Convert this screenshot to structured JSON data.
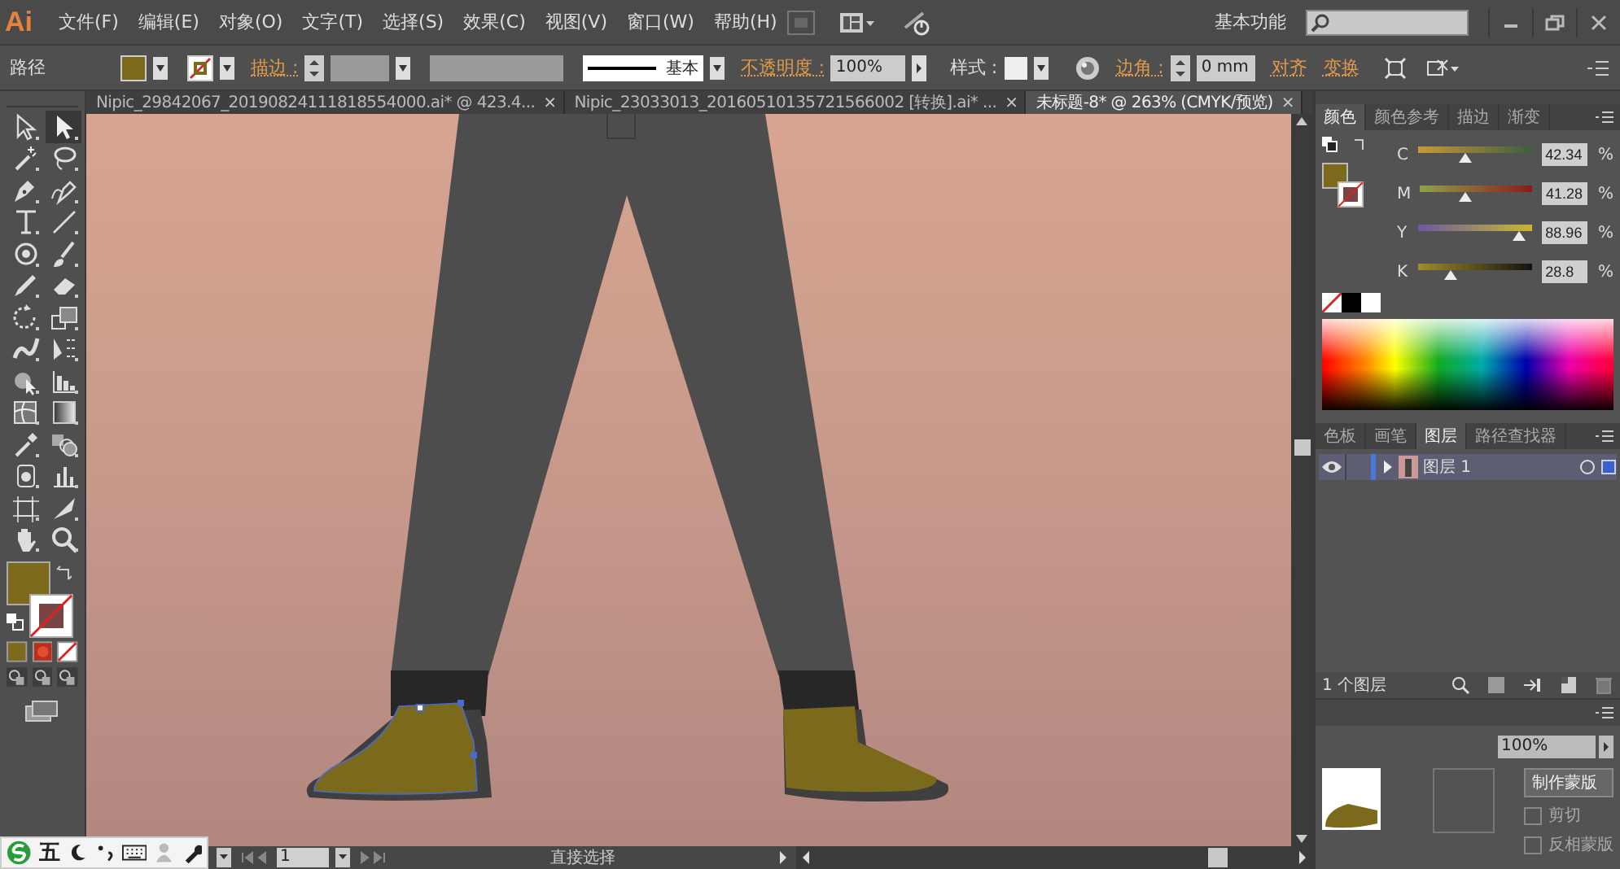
{
  "menu_bar": {
    "logo": "Ai",
    "items": [
      "文件(F)",
      "编辑(E)",
      "对象(O)",
      "文字(T)",
      "选择(S)",
      "效果(C)",
      "视图(V)",
      "窗口(W)",
      "帮助(H)"
    ],
    "workspace": "基本功能"
  },
  "control_bar": {
    "selection": "路径",
    "stroke_link": "描边 :",
    "profile": "基本",
    "opacity_link": "不透明度 :",
    "opacity": "100%",
    "style_label": "样式 :",
    "corner_link": "边角 :",
    "corner": "0 mm",
    "align_link": "对齐",
    "transform_link": "变换"
  },
  "tabs": [
    {
      "label": "Nipic_29842067_20190824111818554000.ai* @ 423.4...",
      "close": "×",
      "selected": false
    },
    {
      "label": "Nipic_23033013_20160510135721566002 [转换].ai* ...",
      "close": "×",
      "selected": false
    },
    {
      "label": "未标题-8* @ 263% (CMYK/预览)",
      "close": "×",
      "selected": true
    }
  ],
  "tools": [
    {
      "kind": "selection",
      "selected": false
    },
    {
      "kind": "direct",
      "selected": true
    },
    {
      "kind": "wand",
      "selected": false
    },
    {
      "kind": "lasso",
      "selected": false
    },
    {
      "kind": "pen",
      "selected": false
    },
    {
      "kind": "curvature",
      "selected": false
    },
    {
      "kind": "type",
      "selected": false
    },
    {
      "kind": "line",
      "selected": false
    },
    {
      "kind": "ellipse",
      "selected": false
    },
    {
      "kind": "brush",
      "selected": false
    },
    {
      "kind": "pencil",
      "selected": false
    },
    {
      "kind": "eraser",
      "selected": false
    },
    {
      "kind": "rotate",
      "selected": false
    },
    {
      "kind": "scale",
      "selected": false
    },
    {
      "kind": "warp",
      "selected": false
    },
    {
      "kind": "freetransform",
      "selected": false
    },
    {
      "kind": "shapebuilder",
      "selected": false
    },
    {
      "kind": "perspective",
      "selected": false
    },
    {
      "kind": "mesh",
      "selected": false
    },
    {
      "kind": "gradient",
      "selected": false
    },
    {
      "kind": "eyedropper",
      "selected": false
    },
    {
      "kind": "blend",
      "selected": false
    },
    {
      "kind": "symbol",
      "selected": false
    },
    {
      "kind": "graph",
      "selected": false
    },
    {
      "kind": "artboard",
      "selected": false
    },
    {
      "kind": "slice",
      "selected": false
    },
    {
      "kind": "hand",
      "selected": false
    },
    {
      "kind": "zoom",
      "selected": false
    }
  ],
  "color_panel": {
    "tabs": [
      {
        "label": "颜色",
        "selected": true
      },
      {
        "label": "颜色参考",
        "selected": false
      },
      {
        "label": "描边",
        "selected": false
      },
      {
        "label": "渐变",
        "selected": false
      }
    ],
    "sliders": [
      {
        "channel": "C",
        "level": 0.42,
        "value": "42.34",
        "unit": "%"
      },
      {
        "channel": "M",
        "level": 0.41,
        "value": "41.28",
        "unit": "%"
      },
      {
        "channel": "Y",
        "level": 0.89,
        "value": "88.96",
        "unit": "%"
      },
      {
        "channel": "K",
        "level": 0.29,
        "value": "28.8",
        "unit": "%"
      }
    ]
  },
  "layers_panel": {
    "tabs": [
      {
        "label": "色板",
        "selected": false
      },
      {
        "label": "画笔",
        "selected": false
      },
      {
        "label": "图层",
        "selected": true
      },
      {
        "label": "路径查找器",
        "selected": false
      }
    ],
    "layers": [
      {
        "name": "图层 1",
        "visible": true,
        "expanded": false
      }
    ],
    "count": "1 个图层"
  },
  "transparency_panel": {
    "opacity": "100%",
    "make_mask": "制作蒙版",
    "clip": "剪切",
    "clip_checked": false,
    "invert": "反相蒙版",
    "invert_checked": false
  },
  "status_bar": {
    "page": "1",
    "tool": "直接选择"
  },
  "ime_bar": {
    "mode": "五"
  }
}
